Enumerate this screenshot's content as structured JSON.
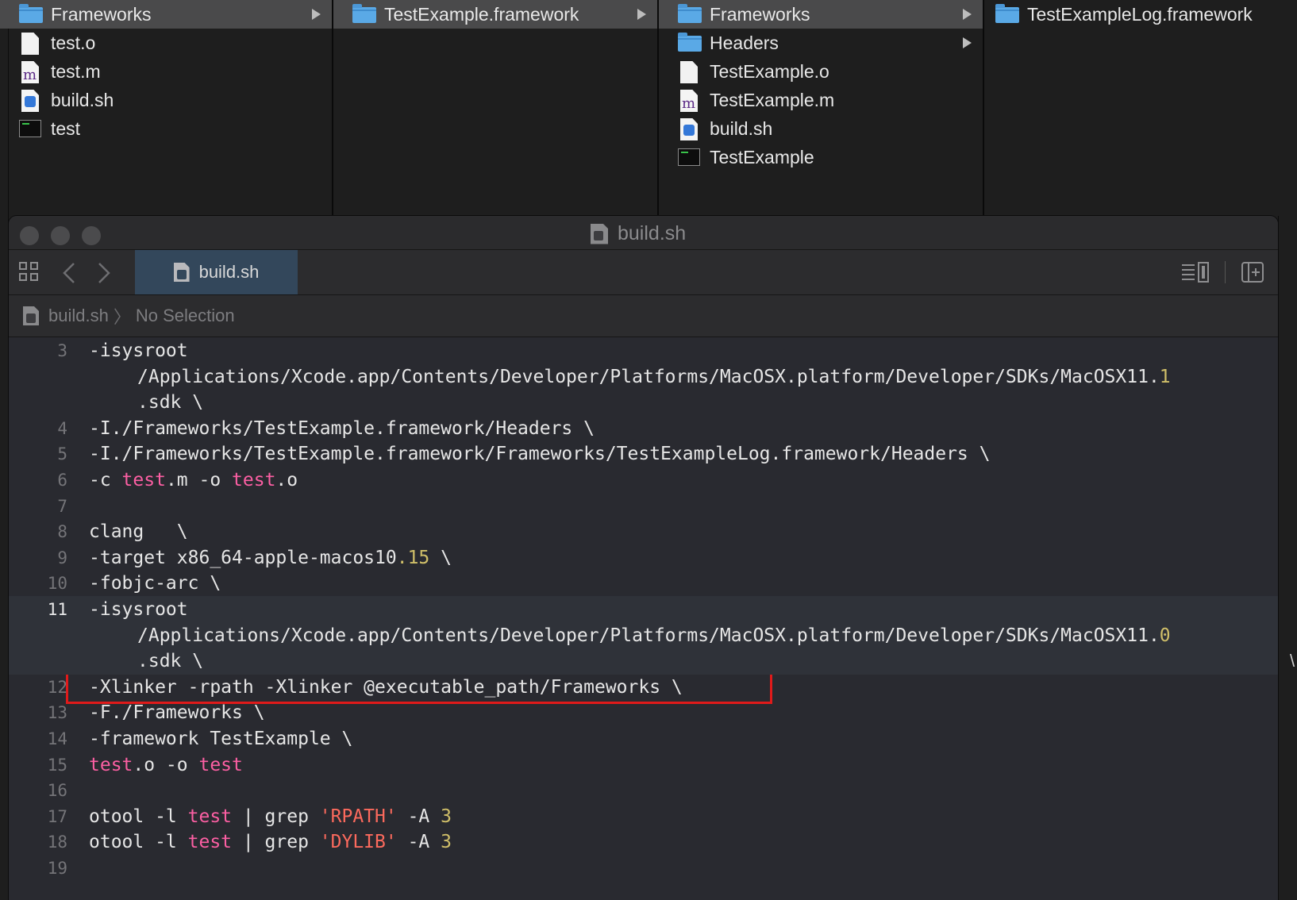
{
  "finder": {
    "columns": [
      {
        "items": [
          {
            "name": "Frameworks",
            "type": "folder",
            "selected": true,
            "has_children": true
          },
          {
            "name": "test.o",
            "type": "doc"
          },
          {
            "name": "test.m",
            "type": "m"
          },
          {
            "name": "build.sh",
            "type": "sh"
          },
          {
            "name": "test",
            "type": "exe"
          }
        ]
      },
      {
        "items": [
          {
            "name": "TestExample.framework",
            "type": "folder",
            "selected": true,
            "has_children": true
          }
        ]
      },
      {
        "items": [
          {
            "name": "Frameworks",
            "type": "folder",
            "selected": true,
            "has_children": true
          },
          {
            "name": "Headers",
            "type": "folder",
            "has_children": true
          },
          {
            "name": "TestExample.o",
            "type": "doc"
          },
          {
            "name": "TestExample.m",
            "type": "m"
          },
          {
            "name": "build.sh",
            "type": "sh"
          },
          {
            "name": "TestExample",
            "type": "exe"
          }
        ]
      },
      {
        "items": [
          {
            "name": "TestExampleLog.framework",
            "type": "folder"
          }
        ]
      }
    ]
  },
  "editor": {
    "window_title": "build.sh",
    "tab_label": "build.sh",
    "jumpbar": {
      "file": "build.sh",
      "separator": "〉",
      "selection": "No Selection"
    },
    "lines": [
      {
        "n": "3",
        "parts": [
          [
            "-isysroot",
            ""
          ]
        ]
      },
      {
        "n": "",
        "wrap": true,
        "parts": [
          [
            "/Applications/Xcode.app/Contents/Developer/Platforms/MacOSX.platform/Developer/SDKs/MacOSX11.",
            ""
          ],
          [
            "1",
            "num"
          ]
        ]
      },
      {
        "n": "",
        "wrap": true,
        "parts": [
          [
            ".sdk \\",
            ""
          ]
        ]
      },
      {
        "n": "4",
        "parts": [
          [
            "-I./Frameworks/TestExample.framework/Headers \\",
            ""
          ]
        ]
      },
      {
        "n": "5",
        "parts": [
          [
            "-I./Frameworks/TestExample.framework/Frameworks/TestExampleLog.framework/Headers \\",
            ""
          ]
        ]
      },
      {
        "n": "6",
        "parts": [
          [
            "-c ",
            ""
          ],
          [
            "test",
            "kw"
          ],
          [
            ".m -o ",
            ""
          ],
          [
            "test",
            "kw"
          ],
          [
            ".o",
            ""
          ]
        ]
      },
      {
        "n": "7",
        "parts": []
      },
      {
        "n": "8",
        "parts": [
          [
            "clang   \\",
            ""
          ]
        ]
      },
      {
        "n": "9",
        "parts": [
          [
            "-target x86_64-apple-macos10",
            ""
          ],
          [
            ".15",
            "num"
          ],
          [
            " \\",
            ""
          ]
        ]
      },
      {
        "n": "10",
        "parts": [
          [
            "-fobjc-arc \\",
            ""
          ]
        ]
      },
      {
        "n": "11",
        "current": true,
        "parts": [
          [
            "-isysroot",
            ""
          ]
        ]
      },
      {
        "n": "",
        "current": true,
        "wrap": true,
        "parts": [
          [
            "/Applications/Xcode.app/Contents/Developer/Platforms/MacOSX.platform/Developer/SDKs/MacOSX11.",
            ""
          ],
          [
            "0",
            "num"
          ]
        ]
      },
      {
        "n": "",
        "current": true,
        "wrap": true,
        "parts": [
          [
            ".sdk \\",
            ""
          ]
        ]
      },
      {
        "n": "12",
        "parts": [
          [
            "-Xlinker -rpath -Xlinker @executable_path/Frameworks \\",
            ""
          ]
        ]
      },
      {
        "n": "13",
        "parts": [
          [
            "-F./Frameworks \\",
            ""
          ]
        ]
      },
      {
        "n": "14",
        "parts": [
          [
            "-framework TestExample \\",
            ""
          ]
        ]
      },
      {
        "n": "15",
        "parts": [
          [
            "test",
            "kw"
          ],
          [
            ".o -o ",
            ""
          ],
          [
            "test",
            "kw"
          ]
        ]
      },
      {
        "n": "16",
        "parts": []
      },
      {
        "n": "17",
        "parts": [
          [
            "otool -l ",
            ""
          ],
          [
            "test",
            "kw"
          ],
          [
            " | grep ",
            ""
          ],
          [
            "'RPATH'",
            "str"
          ],
          [
            " -A ",
            ""
          ],
          [
            "3",
            "num"
          ]
        ]
      },
      {
        "n": "18",
        "parts": [
          [
            "otool -l ",
            ""
          ],
          [
            "test",
            "kw"
          ],
          [
            " | grep ",
            ""
          ],
          [
            "'DYLIB'",
            "str"
          ],
          [
            " -A ",
            ""
          ],
          [
            "3",
            "num"
          ]
        ]
      },
      {
        "n": "19",
        "parts": []
      }
    ]
  },
  "right_fragment": "\\",
  "colors": {
    "keyword": "#fc5fa3",
    "number": "#d0bf69",
    "string": "#fc6a5d",
    "highlight_box": "#e01a1a",
    "tab_active": "#33475b"
  }
}
